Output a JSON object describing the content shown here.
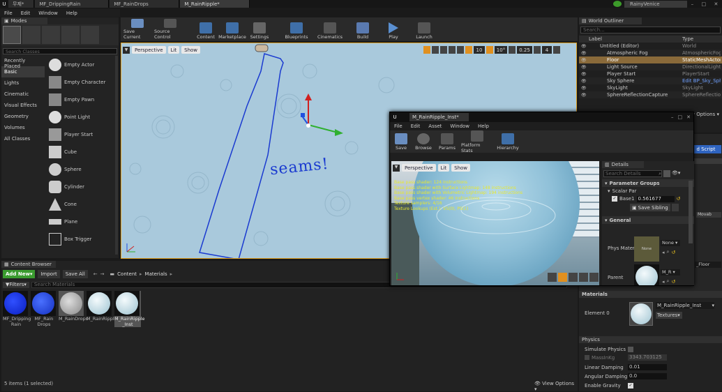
{
  "main": {
    "tabs": [
      "무제*",
      "MF_DrippingRain",
      "MF_RainDrops",
      "M_RainRipple*"
    ],
    "project": "RainyVenice",
    "menu": [
      "File",
      "Edit",
      "Window",
      "Help"
    ]
  },
  "modes": {
    "title": "Modes",
    "search_placeholder": "Search Classes",
    "categories": [
      "Recently Placed",
      "Basic",
      "Lights",
      "Cinematic",
      "Visual Effects",
      "Geometry",
      "Volumes",
      "All Classes"
    ],
    "items": [
      "Empty Actor",
      "Empty Character",
      "Empty Pawn",
      "Point Light",
      "Player Start",
      "Cube",
      "Sphere",
      "Cylinder",
      "Cone",
      "Plane",
      "Box Trigger"
    ]
  },
  "toolbar": [
    "Save Current",
    "Source Control",
    "Content",
    "Marketplace",
    "Settings",
    "Blueprints",
    "Cinematics",
    "Build",
    "Play",
    "Launch"
  ],
  "viewport": {
    "perspective": "Perspective",
    "lit": "Lit",
    "show": "Show",
    "snap_values": [
      "10",
      "10°",
      "0.25",
      "4"
    ],
    "annotation": "seams!"
  },
  "outliner": {
    "title": "World Outliner",
    "search_placeholder": "Search...",
    "col_label": "Label",
    "col_type": "Type",
    "rows": [
      {
        "label": "Untitled (Editor)",
        "type": "World"
      },
      {
        "label": "Atmospheric Fog",
        "type": "AtmosphericFog"
      },
      {
        "label": "Floor",
        "type": "StaticMeshActor"
      },
      {
        "label": "Light Source",
        "type": "DirectionalLight"
      },
      {
        "label": "Player Start",
        "type": "PlayerStart"
      },
      {
        "label": "Sky Sphere",
        "type": "Edit BP_Sky_Sph"
      },
      {
        "label": "SkyLight",
        "type": "SkyLight"
      },
      {
        "label": "SphereReflectionCapture",
        "type": "SphereReflectionC"
      }
    ],
    "view_options": "View Options"
  },
  "material_editor": {
    "title": "M_RainRipple_Inst*",
    "menu": [
      "File",
      "Edit",
      "Asset",
      "Window",
      "Help"
    ],
    "toolbar": [
      "Save",
      "Browse",
      "Params",
      "Platform Stats",
      "Hierarchy"
    ],
    "viewport_buttons": [
      "Perspective",
      "Lit",
      "Show"
    ],
    "stats": [
      "Base pass shader: 124 instructions",
      "Base pass shader with Surface Lightmap: 148 instructions",
      "Base pass shader with Volumetric Lightmap: 194 instructions",
      "Base pass vertex shader: 46 instructions",
      "Texture samplers: 4/16",
      "Texture Lookups (Est.): VS(0), PS(1)"
    ],
    "details_title": "Details",
    "details_search": "Search Details",
    "param_groups": "Parameter Groups",
    "scalar_par": "Scalar Par",
    "base_label": "Base1",
    "base_value": "0.561677",
    "save_sibling": "Save Sibling",
    "general": "General",
    "phys_mat": "Phys Mater",
    "phys_none": "None",
    "phys_dropdown": "None",
    "parent": "Parent",
    "parent_value": "M_R"
  },
  "details_right": {
    "add_script": "d Script",
    "options": "Options",
    "floor_label": "_Floor",
    "movable": "Movab",
    "materials_header": "Materials",
    "element0": "Element 0",
    "material_name": "M_RainRipple_Inst",
    "textures": "Textures",
    "physics_header": "Physics",
    "simulate_physics": "Simulate Physics",
    "mass_label": "MassInKg",
    "mass_value": "3343.703125",
    "linear_damping": "Linear Damping",
    "linear_value": "0.01",
    "angular_damping": "Angular Damping",
    "angular_value": "0.0",
    "enable_gravity": "Enable Gravity"
  },
  "content_browser": {
    "title": "Content Browser",
    "add_new": "Add New",
    "import": "Import",
    "save_all": "Save All",
    "path": [
      "Content",
      "Materials"
    ],
    "filters": "Filters",
    "search_placeholder": "Search Materials",
    "assets": [
      "MF_Dripping Rain",
      "MF_Rain Drops",
      "M_RainDrops",
      "M_RainRipple",
      "M_RainRipple _Inst"
    ],
    "status": "5 items (1 selected)",
    "view_options": "View Options"
  }
}
